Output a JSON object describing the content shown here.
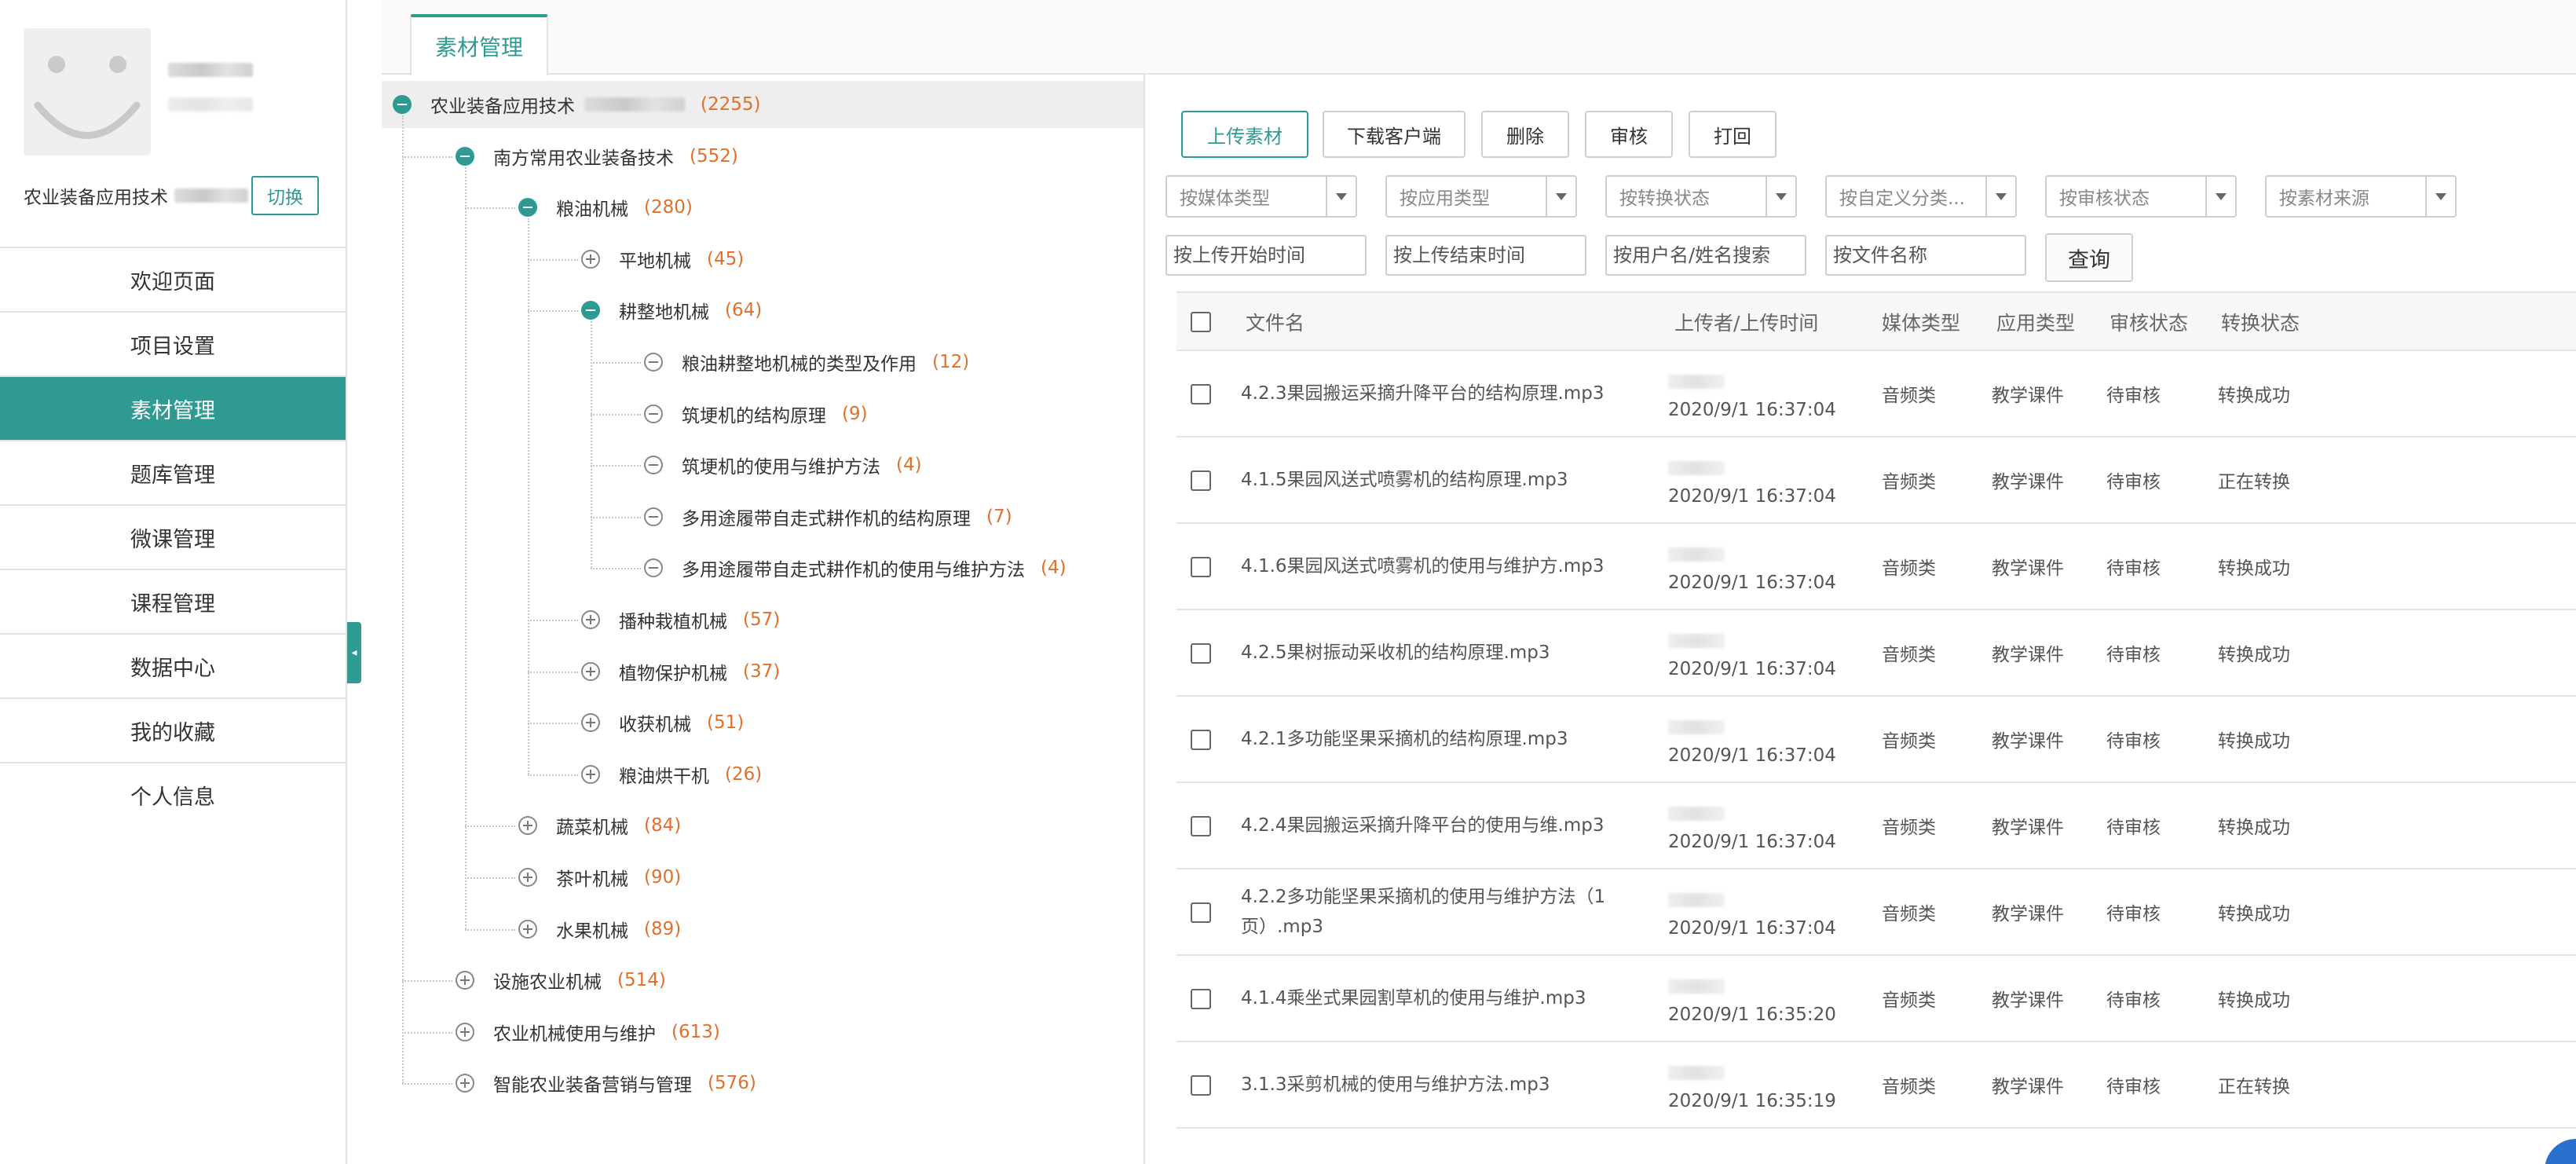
{
  "sidebar": {
    "org_name": "农业装备应用技术",
    "switch_label": "切换",
    "avatar_icon": "smiley-avatar-icon",
    "items": [
      {
        "label": "欢迎页面",
        "active": false
      },
      {
        "label": "项目设置",
        "active": false
      },
      {
        "label": "素材管理",
        "active": true
      },
      {
        "label": "题库管理",
        "active": false
      },
      {
        "label": "微课管理",
        "active": false
      },
      {
        "label": "课程管理",
        "active": false
      },
      {
        "label": "数据中心",
        "active": false
      },
      {
        "label": "我的收藏",
        "active": false
      },
      {
        "label": "个人信息",
        "active": false
      }
    ],
    "collapse_glyph": "◂"
  },
  "tabs": {
    "active_label": "素材管理"
  },
  "tree": {
    "nodes": [
      {
        "label": "农业装备应用技术",
        "count": "(2255)",
        "state": "minus"
      },
      {
        "label": "南方常用农业装备技术",
        "count": "(552)",
        "state": "minus"
      },
      {
        "label": "粮油机械",
        "count": "(280)",
        "state": "minus"
      },
      {
        "label": "平地机械",
        "count": "(45)",
        "state": "plus"
      },
      {
        "label": "耕整地机械",
        "count": "(64)",
        "state": "minus"
      },
      {
        "label": "粮油耕整地机械的类型及作用",
        "count": "(12)",
        "state": "leaf"
      },
      {
        "label": "筑埂机的结构原理",
        "count": "(9)",
        "state": "leaf"
      },
      {
        "label": "筑埂机的使用与维护方法",
        "count": "(4)",
        "state": "leaf"
      },
      {
        "label": "多用途履带自走式耕作机的结构原理",
        "count": "(7)",
        "state": "leaf"
      },
      {
        "label": "多用途履带自走式耕作机的使用与维护方法",
        "count": "(4)",
        "state": "leaf"
      },
      {
        "label": "播种栽植机械",
        "count": "(57)",
        "state": "plus"
      },
      {
        "label": "植物保护机械",
        "count": "(37)",
        "state": "plus"
      },
      {
        "label": "收获机械",
        "count": "(51)",
        "state": "plus"
      },
      {
        "label": "粮油烘干机",
        "count": "(26)",
        "state": "plus"
      },
      {
        "label": "蔬菜机械",
        "count": "(84)",
        "state": "plus"
      },
      {
        "label": "茶叶机械",
        "count": "(90)",
        "state": "plus"
      },
      {
        "label": "水果机械",
        "count": "(89)",
        "state": "plus"
      },
      {
        "label": "设施农业机械",
        "count": "(514)",
        "state": "plus"
      },
      {
        "label": "农业机械使用与维护",
        "count": "(613)",
        "state": "plus"
      },
      {
        "label": "智能农业装备营销与管理",
        "count": "(576)",
        "state": "plus"
      }
    ]
  },
  "toolbar": {
    "upload": "上传素材",
    "download_client": "下载客户端",
    "delete": "删除",
    "review": "审核",
    "reject": "打回"
  },
  "filters": {
    "media_type": "按媒体类型",
    "app_type": "按应用类型",
    "convert_status": "按转换状态",
    "custom_category": "按自定义分类...",
    "audit_status": "按审核状态",
    "source": "按素材来源",
    "start_time": "按上传开始时间",
    "end_time": "按上传结束时间",
    "user_search": "按用户名/姓名搜索",
    "file_name": "按文件名称",
    "query": "查询"
  },
  "table": {
    "headers": {
      "filename": "文件名",
      "uploader_time": "上传者/上传时间",
      "media": "媒体类型",
      "app": "应用类型",
      "audit": "审核状态",
      "convert": "转换状态"
    },
    "rows": [
      {
        "filename": "4.2.3果园搬运采摘升降平台的结构原理.mp3",
        "time": "2020/9/1 16:37:04",
        "media": "音频类",
        "app": "教学课件",
        "audit": "待审核",
        "convert": "转换成功"
      },
      {
        "filename": "4.1.5果园风送式喷雾机的结构原理.mp3",
        "time": "2020/9/1 16:37:04",
        "media": "音频类",
        "app": "教学课件",
        "audit": "待审核",
        "convert": "正在转换"
      },
      {
        "filename": "4.1.6果园风送式喷雾机的使用与维护方.mp3",
        "time": "2020/9/1 16:37:04",
        "media": "音频类",
        "app": "教学课件",
        "audit": "待审核",
        "convert": "转换成功"
      },
      {
        "filename": "4.2.5果树振动采收机的结构原理.mp3",
        "time": "2020/9/1 16:37:04",
        "media": "音频类",
        "app": "教学课件",
        "audit": "待审核",
        "convert": "转换成功"
      },
      {
        "filename": "4.2.1多功能坚果采摘机的结构原理.mp3",
        "time": "2020/9/1 16:37:04",
        "media": "音频类",
        "app": "教学课件",
        "audit": "待审核",
        "convert": "转换成功"
      },
      {
        "filename": "4.2.4果园搬运采摘升降平台的使用与维.mp3",
        "time": "2020/9/1 16:37:04",
        "media": "音频类",
        "app": "教学课件",
        "audit": "待审核",
        "convert": "转换成功"
      },
      {
        "filename": "4.2.2多功能坚果采摘机的使用与维护方法（1页）.mp3",
        "time": "2020/9/1 16:37:04",
        "media": "音频类",
        "app": "教学课件",
        "audit": "待审核",
        "convert": "转换成功"
      },
      {
        "filename": "4.1.4乘坐式果园割草机的使用与维护.mp3",
        "time": "2020/9/1 16:35:20",
        "media": "音频类",
        "app": "教学课件",
        "audit": "待审核",
        "convert": "转换成功"
      },
      {
        "filename": "3.1.3采剪机械的使用与维护方法.mp3",
        "time": "2020/9/1 16:35:19",
        "media": "音频类",
        "app": "教学课件",
        "audit": "待审核",
        "convert": "正在转换"
      }
    ]
  },
  "colors": {
    "accent": "#2f9a92",
    "count": "#e0702a"
  }
}
